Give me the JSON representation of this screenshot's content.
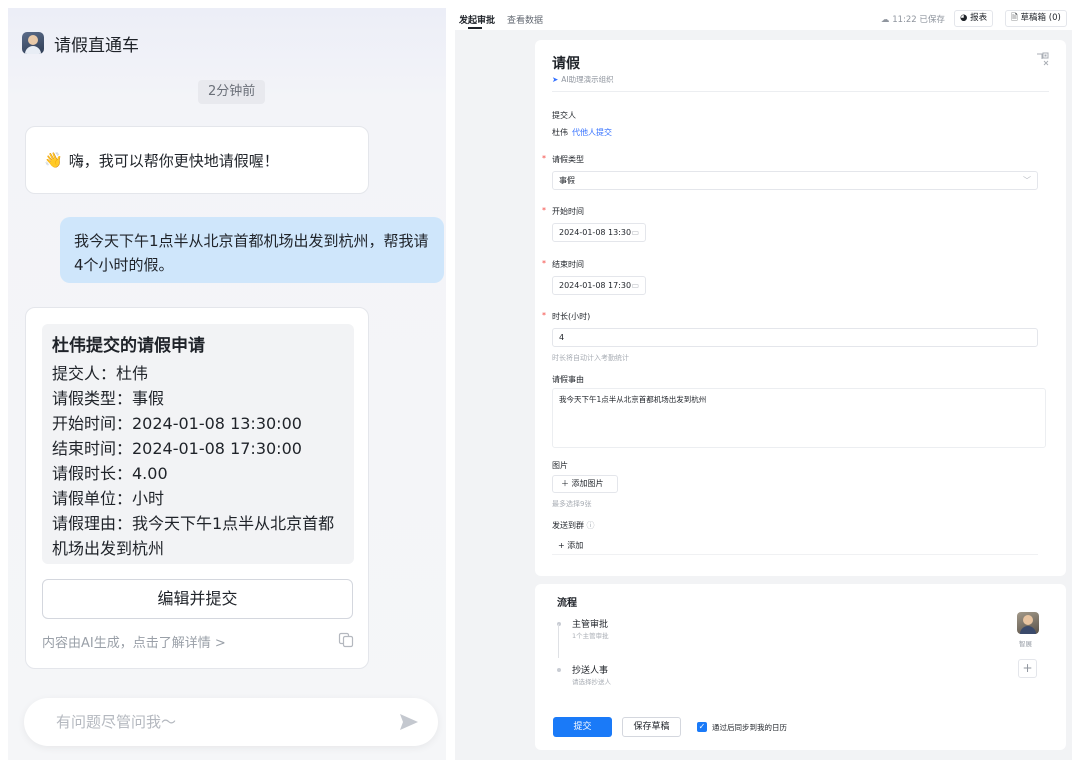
{
  "chat": {
    "title": "请假直通车",
    "time_chip": "2分钟前",
    "bot_greeting": "嗨，我可以帮你更快地请假喔！",
    "user_message": "我今天下午1点半从北京首都机场出发到杭州，帮我请4个小时的假。",
    "card": {
      "title": "杜伟提交的请假申请",
      "lines": [
        "提交人：杜伟",
        "请假类型：事假",
        "开始时间：2024-01-08 13:30:00",
        "结束时间：2024-01-08 17:30:00",
        "请假时长：4.00",
        "请假单位：小时",
        "请假理由：我今天下午1点半从北京首都机场出发到杭州"
      ],
      "button_label": "编辑并提交",
      "footer": "内容由AI生成，点击了解详情 >"
    },
    "input_placeholder": "有问题尽管问我～"
  },
  "form": {
    "topbar": {
      "tabs": [
        "发起审批",
        "查看数据"
      ],
      "status": "11:22 已保存",
      "report_label": "报表",
      "drafts_label": "草稿箱 (0)"
    },
    "title": "请假",
    "subtitle": "AI助理演示组织",
    "submitter_label": "提交人",
    "submitter_name": "杜伟",
    "submitter_link": "代他人提交",
    "leave_type_label": "请假类型",
    "leave_type_value": "事假",
    "start_label": "开始时间",
    "start_value": "2024-01-08 13:30",
    "end_label": "结束时间",
    "end_value": "2024-01-08 17:30",
    "duration_label": "时长(小时)",
    "duration_value": "4",
    "duration_help": "时长将自动计入考勤统计",
    "reason_label": "请假事由",
    "reason_value": "我今天下午1点半从北京首都机场出发到杭州",
    "image_label": "图片",
    "image_button": "添加图片",
    "image_help": "最多选择9张",
    "cc_group_label": "发送到群",
    "cc_group_add": "+ 添加"
  },
  "flow": {
    "title": "流程",
    "approve_name": "主管审批",
    "approve_desc": "1个主管审批",
    "approver_name": "智展",
    "cc_name": "抄送人事",
    "cc_desc": "请选择抄送人",
    "submit_label": "提交",
    "draft_label": "保存草稿",
    "sync_label": "通过后同步到我的日历"
  }
}
